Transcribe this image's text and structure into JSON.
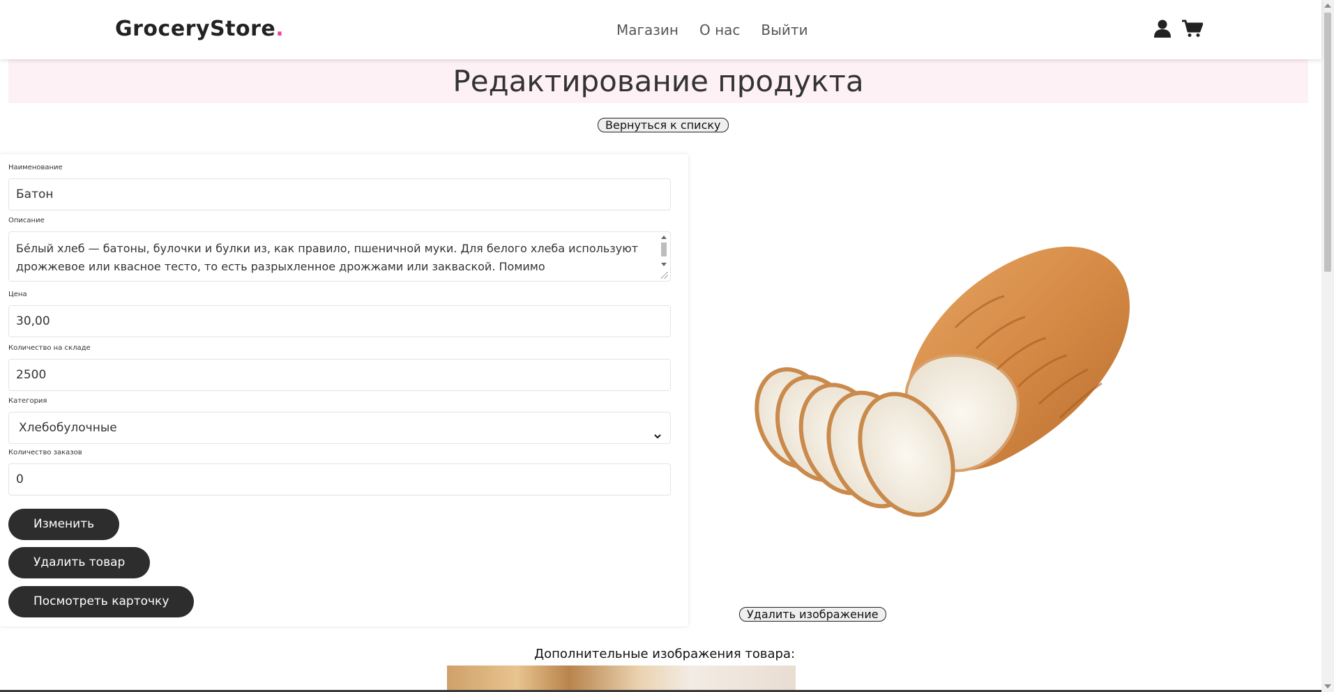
{
  "header": {
    "logo_text": "GroceryStore",
    "logo_dot": ".",
    "nav": [
      "Магазин",
      "О нас",
      "Выйти"
    ],
    "icons": [
      "user-icon",
      "cart-icon"
    ]
  },
  "page": {
    "title": "Редактирование продукта",
    "back_button": "Вернуться к списку"
  },
  "form": {
    "name_label": "Наименование",
    "name_value": "Батон",
    "description_label": "Описание",
    "description_value": "Бе́лый хлеб — батоны, булочки и булки из, как правило, пшеничной муки. Для белого хлеба используют дрожжевое или квасное тесто, то есть разрыхленное дрожжами или закваской. Помимо",
    "price_label": "Цена",
    "price_value": "30,00",
    "stock_label": "Количество на складе",
    "stock_value": "2500",
    "category_label": "Категория",
    "category_value": "Хлебобулочные",
    "orders_label": "Количество заказов",
    "orders_value": "0",
    "buttons": {
      "update": "Изменить",
      "delete": "Удалить товар",
      "view_card": "Посмотреть карточку"
    }
  },
  "image_panel": {
    "delete_image_button": "Удалить изображение",
    "extra_images_title": "Дополнительные изображения товара:"
  },
  "colors": {
    "accent": "#e84393",
    "title_band": "#fdf1f6",
    "dark_button": "#2d2d2d"
  }
}
